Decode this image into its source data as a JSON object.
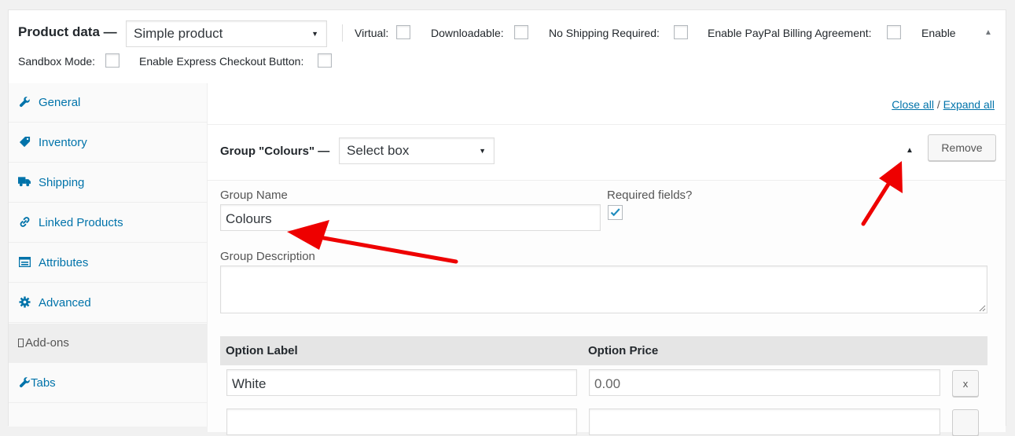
{
  "header": {
    "title": "Product data —",
    "product_type": "Simple product",
    "options": {
      "virtual": "Virtual:",
      "downloadable": "Downloadable:",
      "no_shipping": "No Shipping Required:",
      "paypal_billing": "Enable PayPal Billing Agreement:",
      "enable": "Enable",
      "sandbox": "Sandbox Mode:",
      "express_checkout": "Enable Express Checkout Button:"
    }
  },
  "sidebar": {
    "items": [
      {
        "label": "General",
        "icon": "wrench-icon"
      },
      {
        "label": "Inventory",
        "icon": "tag-icon"
      },
      {
        "label": "Shipping",
        "icon": "truck-icon"
      },
      {
        "label": "Linked Products",
        "icon": "link-icon"
      },
      {
        "label": "Attributes",
        "icon": "list-icon"
      },
      {
        "label": "Advanced",
        "icon": "gear-icon"
      },
      {
        "label": "Add-ons",
        "icon": "missing-glyph-icon"
      },
      {
        "label": "Tabs",
        "icon": "wrench-icon"
      }
    ],
    "active": "Add-ons"
  },
  "toolbar": {
    "close_all": "Close all",
    "separator": "/",
    "expand_all": "Expand all"
  },
  "group": {
    "title": "Group \"Colours\" —",
    "type": "Select box",
    "remove_label": "Remove",
    "name_label": "Group Name",
    "name_value": "Colours",
    "required_label": "Required fields?",
    "required_checked": true,
    "description_label": "Group Description",
    "description_value": "",
    "option_label_header": "Option Label",
    "option_price_header": "Option Price",
    "rows": [
      {
        "label": "White",
        "price_placeholder": "0.00",
        "remove": "x"
      }
    ]
  },
  "colors": {
    "link": "#0073aa",
    "annotation": "#ee0000"
  }
}
